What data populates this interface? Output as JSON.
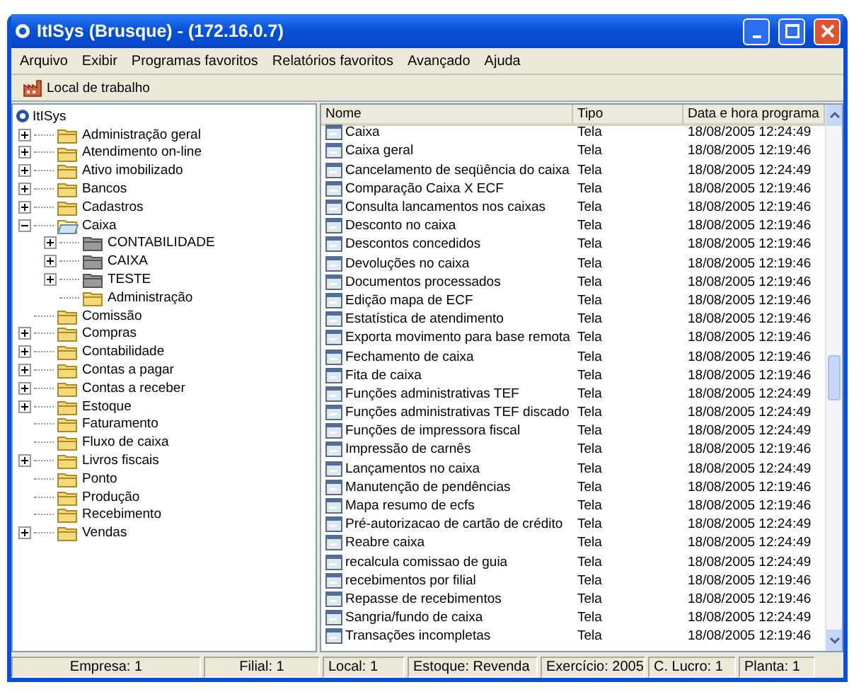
{
  "window": {
    "title": "ItISys (Brusque) - (172.16.0.7)"
  },
  "menu": [
    "Arquivo",
    "Exibir",
    "Programas favoritos",
    "Relatórios favoritos",
    "Avançado",
    "Ajuda"
  ],
  "toolbar": [
    {
      "label": "Local de trabalho"
    }
  ],
  "tree": {
    "root": "ItISys",
    "items": [
      {
        "label": "Administração geral",
        "kind": "folder",
        "expanded": false
      },
      {
        "label": "Atendimento on-line",
        "kind": "folder",
        "expanded": false
      },
      {
        "label": "Ativo imobilizado",
        "kind": "folder",
        "expanded": false
      },
      {
        "label": "Bancos",
        "kind": "folder",
        "expanded": false
      },
      {
        "label": "Cadastros",
        "kind": "folder",
        "expanded": false
      },
      {
        "label": "Caixa",
        "kind": "folder",
        "expanded": true,
        "children": [
          {
            "label": "CONTABILIDADE",
            "kind": "gray-folder",
            "expanded": false
          },
          {
            "label": "CAIXA",
            "kind": "gray-folder",
            "expanded": false
          },
          {
            "label": "TESTE",
            "kind": "gray-folder",
            "expanded": false
          },
          {
            "label": "Administração",
            "kind": "folder"
          }
        ]
      },
      {
        "label": "Comissão",
        "kind": "folder"
      },
      {
        "label": "Compras",
        "kind": "folder",
        "expanded": false
      },
      {
        "label": "Contabilidade",
        "kind": "folder",
        "expanded": false
      },
      {
        "label": "Contas a pagar",
        "kind": "folder",
        "expanded": false
      },
      {
        "label": "Contas a receber",
        "kind": "folder",
        "expanded": false
      },
      {
        "label": "Estoque",
        "kind": "folder",
        "expanded": false
      },
      {
        "label": "Faturamento",
        "kind": "folder"
      },
      {
        "label": "Fluxo de caixa",
        "kind": "folder"
      },
      {
        "label": "Livros fiscais",
        "kind": "folder",
        "expanded": false
      },
      {
        "label": "Ponto",
        "kind": "folder"
      },
      {
        "label": "Produção",
        "kind": "folder"
      },
      {
        "label": "Recebimento",
        "kind": "folder"
      },
      {
        "label": "Vendas",
        "kind": "folder",
        "expanded": false
      }
    ]
  },
  "table": {
    "columns": [
      "Nome",
      "Tipo",
      "Data e hora programa"
    ],
    "rows": [
      [
        "Caixa",
        "Tela",
        "18/08/2005 12:24:49"
      ],
      [
        "Caixa geral",
        "Tela",
        "18/08/2005 12:19:46"
      ],
      [
        "Cancelamento de seqüência do caixa",
        "Tela",
        "18/08/2005 12:24:49"
      ],
      [
        "Comparação Caixa X ECF",
        "Tela",
        "18/08/2005 12:19:46"
      ],
      [
        "Consulta lancamentos nos caixas",
        "Tela",
        "18/08/2005 12:19:46"
      ],
      [
        "Desconto no caixa",
        "Tela",
        "18/08/2005 12:19:46"
      ],
      [
        "Descontos concedidos",
        "Tela",
        "18/08/2005 12:19:46"
      ],
      [
        "Devoluções no caixa",
        "Tela",
        "18/08/2005 12:19:46"
      ],
      [
        "Documentos processados",
        "Tela",
        "18/08/2005 12:19:46"
      ],
      [
        "Edição mapa de ECF",
        "Tela",
        "18/08/2005 12:19:46"
      ],
      [
        "Estatística de atendimento",
        "Tela",
        "18/08/2005 12:19:46"
      ],
      [
        "Exporta movimento para base remota",
        "Tela",
        "18/08/2005 12:19:46"
      ],
      [
        "Fechamento de caixa",
        "Tela",
        "18/08/2005 12:19:46"
      ],
      [
        "Fita de caixa",
        "Tela",
        "18/08/2005 12:19:46"
      ],
      [
        "Funções administrativas TEF",
        "Tela",
        "18/08/2005 12:24:49"
      ],
      [
        "Funções administrativas TEF discado",
        "Tela",
        "18/08/2005 12:24:49"
      ],
      [
        "Funções de impressora fiscal",
        "Tela",
        "18/08/2005 12:24:49"
      ],
      [
        "Impressão de carnês",
        "Tela",
        "18/08/2005 12:19:46"
      ],
      [
        "Lançamentos no caixa",
        "Tela",
        "18/08/2005 12:24:49"
      ],
      [
        "Manutenção de pendências",
        "Tela",
        "18/08/2005 12:19:46"
      ],
      [
        "Mapa resumo de ecfs",
        "Tela",
        "18/08/2005 12:19:46"
      ],
      [
        "Pré-autorizacao de cartão de crédito",
        "Tela",
        "18/08/2005 12:24:49"
      ],
      [
        "Reabre caixa",
        "Tela",
        "18/08/2005 12:24:49"
      ],
      [
        "recalcula comissao de guia",
        "Tela",
        "18/08/2005 12:24:49"
      ],
      [
        "recebimentos por filial",
        "Tela",
        "18/08/2005 12:19:46"
      ],
      [
        "Repasse de recebimentos",
        "Tela",
        "18/08/2005 12:19:46"
      ],
      [
        "Sangria/fundo de caixa",
        "Tela",
        "18/08/2005 12:24:49"
      ],
      [
        "Transações incompletas",
        "Tela",
        "18/08/2005 12:19:46"
      ]
    ]
  },
  "status_bar": [
    "Empresa: 1",
    "Filial: 1",
    "Local: 1",
    "Estoque: Revenda",
    "Exercício: 2005",
    "C. Lucro: 1",
    "Planta: 1"
  ]
}
